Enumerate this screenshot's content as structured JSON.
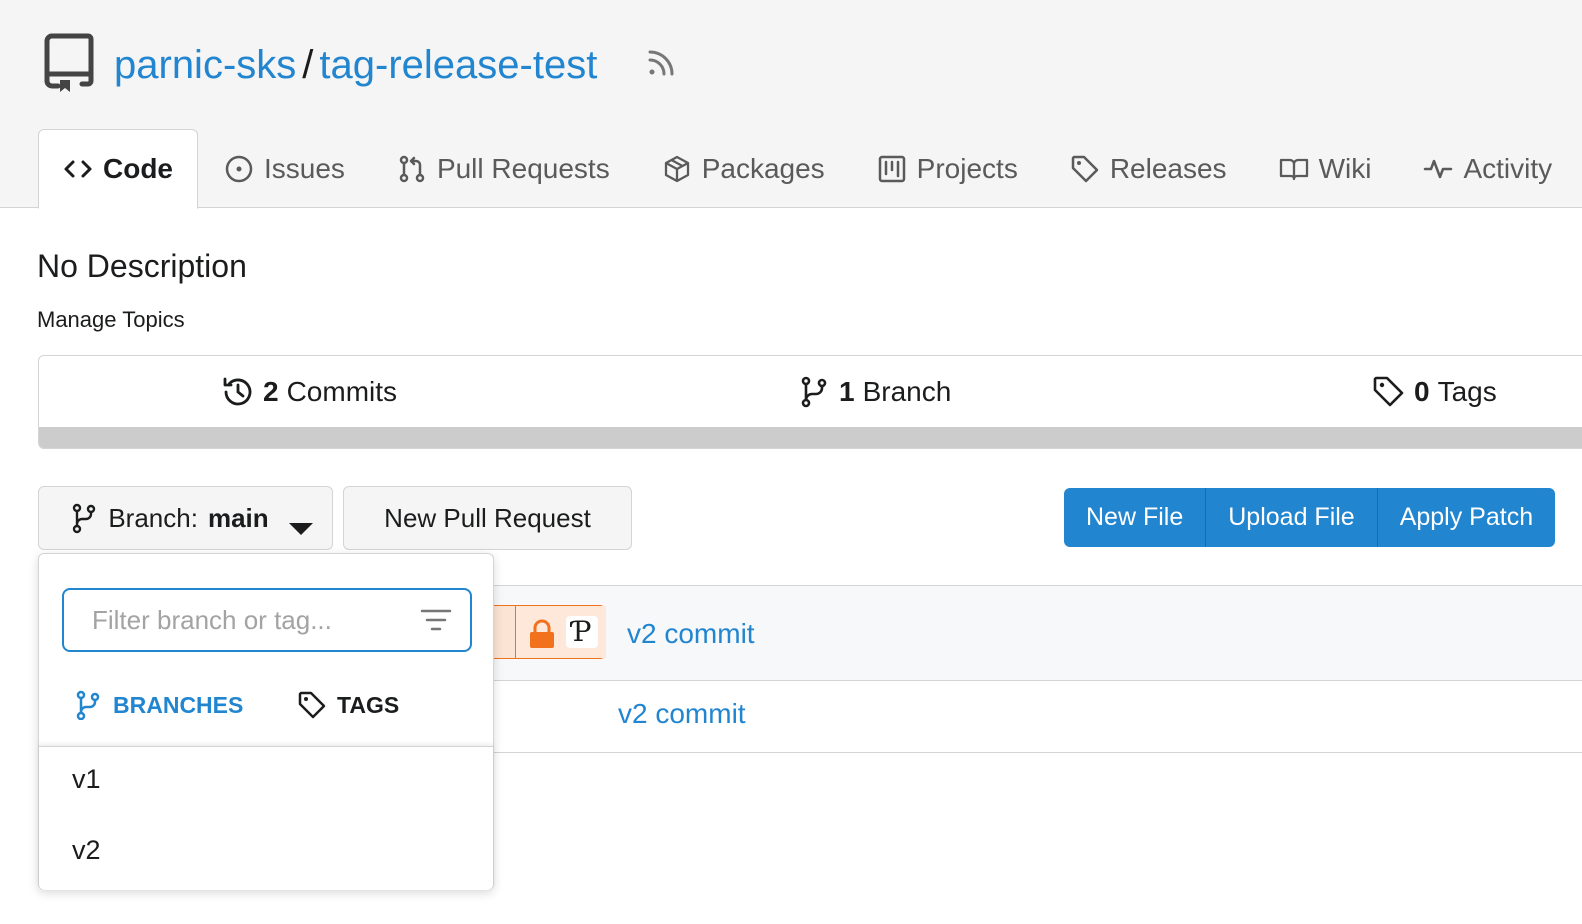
{
  "repo": {
    "owner": "parnic-sks",
    "separator": "/",
    "name": "tag-release-test"
  },
  "tabs": [
    {
      "label": "Code",
      "icon": "code-icon",
      "active": true
    },
    {
      "label": "Issues",
      "icon": "issue-icon"
    },
    {
      "label": "Pull Requests",
      "icon": "pull-request-icon"
    },
    {
      "label": "Packages",
      "icon": "package-icon"
    },
    {
      "label": "Projects",
      "icon": "project-icon"
    },
    {
      "label": "Releases",
      "icon": "tag-icon"
    },
    {
      "label": "Wiki",
      "icon": "book-icon"
    },
    {
      "label": "Activity",
      "icon": "pulse-icon"
    }
  ],
  "description": "No Description",
  "manage_topics": "Manage Topics",
  "stats": {
    "commits": {
      "count": "2",
      "label": "Commits"
    },
    "branches": {
      "count": "1",
      "label": "Branch"
    },
    "tags": {
      "count": "0",
      "label": "Tags"
    }
  },
  "branch_button": {
    "prefix": "Branch:",
    "value": "main"
  },
  "new_pr_label": "New Pull Request",
  "file_actions": [
    "New File",
    "Upload File",
    "Apply Patch"
  ],
  "latest_commit": {
    "message": "v2 commit"
  },
  "files": [
    {
      "message": "v2 commit"
    }
  ],
  "dropdown": {
    "filter_placeholder": "Filter branch or tag...",
    "tab_branches": "BRANCHES",
    "tab_tags": "TAGS",
    "items": [
      "v1",
      "v2"
    ]
  },
  "colors": {
    "accent": "#2185d0",
    "header_bg": "#f5f5f5",
    "signature_warning": "#f2711c"
  }
}
